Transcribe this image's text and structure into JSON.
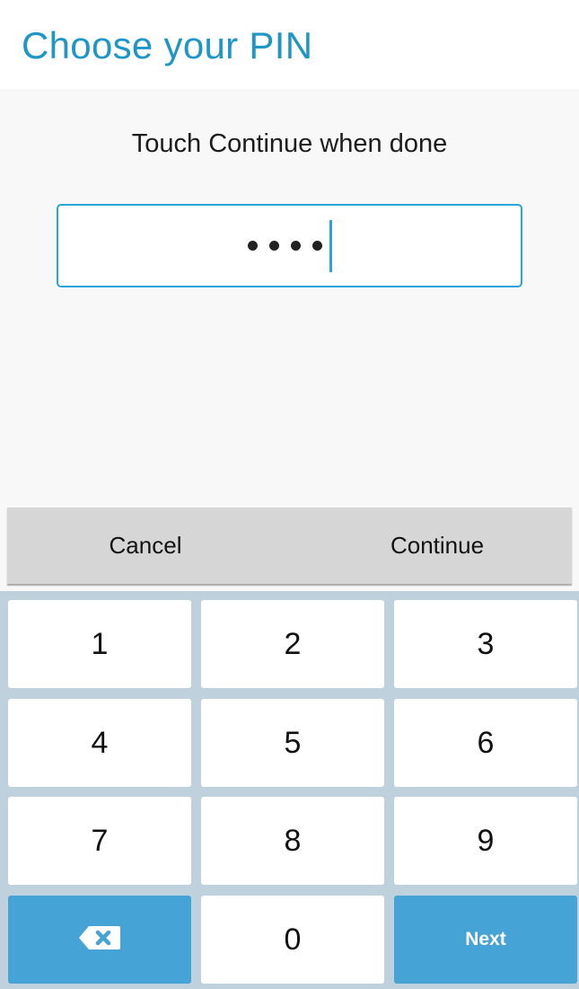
{
  "header": {
    "title": "Choose your PIN",
    "accent_color": "#1e96c8"
  },
  "prompt": "Touch Continue when done",
  "pin_field": {
    "masked_value": "••••",
    "digits_entered": 4,
    "border_color": "#2aa5d8"
  },
  "actions": {
    "cancel_label": "Cancel",
    "continue_label": "Continue"
  },
  "keypad": {
    "keys": [
      "1",
      "2",
      "3",
      "4",
      "5",
      "6",
      "7",
      "8",
      "9"
    ],
    "zero": "0",
    "backspace_icon": "backspace-icon",
    "next_label": "Next",
    "key_accent_color": "#46a3d5",
    "background_color": "#bfd1dd"
  }
}
